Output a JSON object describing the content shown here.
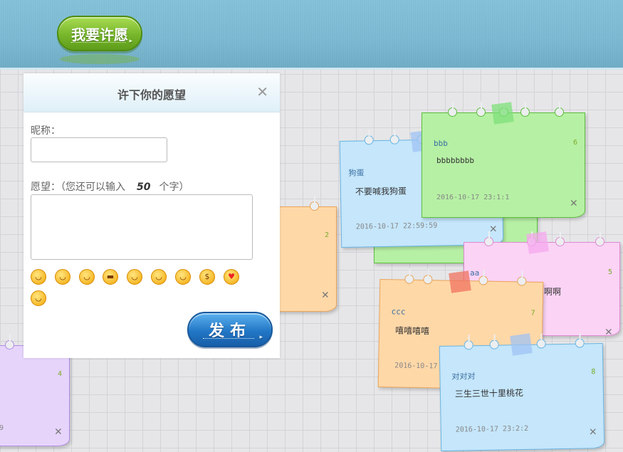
{
  "header": {
    "wish_button_label": "我要许愿"
  },
  "dialog": {
    "title": "许下你的愿望",
    "close_icon": "×",
    "nickname_label": "昵称：",
    "wish_label_prefix": "愿望：（您还可以输入",
    "remaining_chars": "50",
    "wish_label_suffix": "个字）",
    "publish_label": "发布",
    "emojis": [
      "grin-sweat",
      "cover-mouth",
      "smile-blush",
      "sunglasses",
      "grin",
      "hug",
      "shy",
      "money-eyes",
      "heart-eyes",
      "smile"
    ]
  },
  "notes": {
    "bbb": {
      "name": "bbb",
      "num": "6",
      "content": "bbbbbbbb",
      "time": "2016-10-17 23:1:1",
      "color": "#b6f0a4"
    },
    "goudan": {
      "name": "狗蛋",
      "num": "",
      "content": "不要喊我狗蛋",
      "time": "2016-10-17 22:59:59",
      "color": "#c5e6fb"
    },
    "orange_left": {
      "num": "2",
      "color": "#ffd8a8"
    },
    "aa": {
      "name": "aa",
      "num": "5",
      "content": "啊啊",
      "color": "#fbd3f5"
    },
    "ccc": {
      "name": "ccc",
      "num": "7",
      "content": "嘻嘻嘻嘻",
      "time": "2016-10-17 2",
      "color": "#ffd8a8"
    },
    "duiduidui": {
      "name": "对对对",
      "num": "8",
      "content": "三生三世十里桃花",
      "time": "2016-10-17 23:2:2",
      "color": "#c5e6fb"
    },
    "purple_left": {
      "num": "4",
      "time": "9",
      "color": "#e6d4fb"
    }
  }
}
